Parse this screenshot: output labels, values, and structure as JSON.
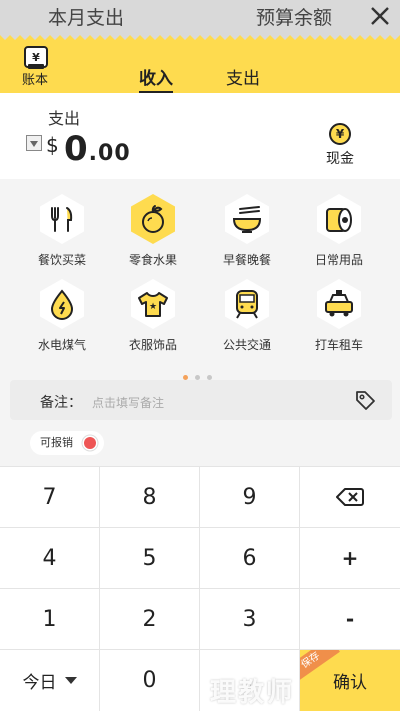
{
  "topbar": {
    "left_title": "本月支出",
    "right_title": "预算余额"
  },
  "header": {
    "book_label": "账本",
    "tabs": [
      {
        "label": "收入"
      },
      {
        "label": "支出"
      }
    ]
  },
  "entry": {
    "type_label": "支出",
    "currency": "$",
    "amount_int": "0",
    "amount_dec": ".00",
    "account_label": "现金"
  },
  "categories": [
    {
      "label": "餐饮买菜",
      "icon": "fork-knife-icon"
    },
    {
      "label": "零食水果",
      "icon": "apple-icon"
    },
    {
      "label": "早餐晚餐",
      "icon": "noodle-bowl-icon"
    },
    {
      "label": "日常用品",
      "icon": "tissue-roll-icon"
    },
    {
      "label": "水电煤气",
      "icon": "utility-drop-icon"
    },
    {
      "label": "衣服饰品",
      "icon": "tshirt-icon"
    },
    {
      "label": "公共交通",
      "icon": "train-icon"
    },
    {
      "label": "打车租车",
      "icon": "taxi-icon"
    }
  ],
  "pager": {
    "pages": 3,
    "active": 1
  },
  "remark": {
    "label": "备注：",
    "placeholder": "点击填写备注"
  },
  "reimbursable": {
    "label": "可报销"
  },
  "keypad": {
    "keys": [
      "7",
      "8",
      "9",
      "4",
      "5",
      "6",
      "+",
      "1",
      "2",
      "3",
      "-",
      "今日",
      "0",
      ".",
      "确认"
    ],
    "done_badge": "保存"
  },
  "colors": {
    "accent": "#fedb4f",
    "badge": "#f08f4a",
    "reimb_dot": "#ee5555"
  },
  "watermark": "理教师"
}
